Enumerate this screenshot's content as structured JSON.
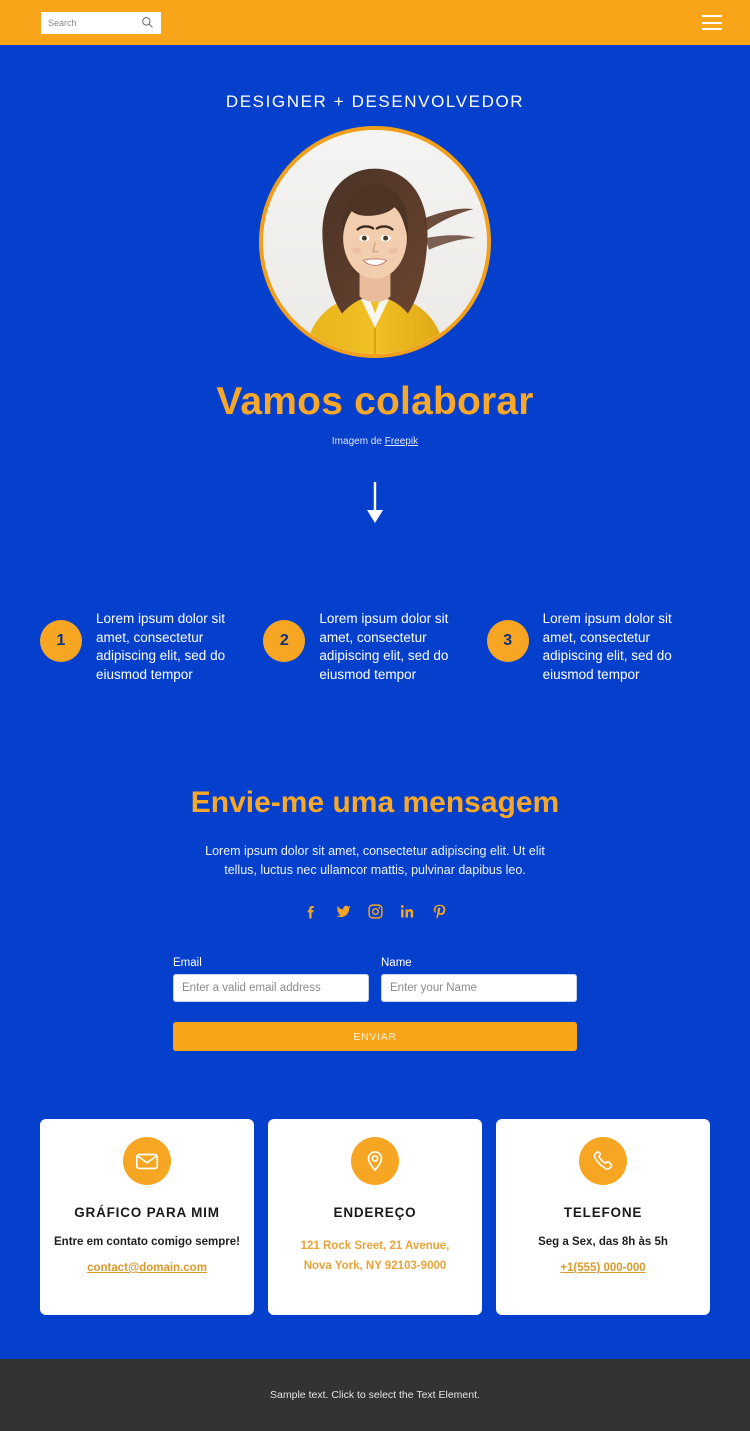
{
  "colors": {
    "background_blue": "#0540cc",
    "accent_orange": "#f9a51a",
    "title_orange": "#f7a82a",
    "footer_dark": "#333333",
    "card_white": "#ffffff"
  },
  "header": {
    "search": {
      "placeholder": "Search",
      "value": "",
      "icon": "search-icon"
    },
    "menu_icon": "hamburger-menu-icon"
  },
  "hero": {
    "eyebrow": "DESIGNER + DESENVOLVEDOR",
    "portrait_alt": "portrait-photo",
    "title": "Vamos colaborar",
    "credit_prefix": "Imagem de ",
    "credit_link": "Freepik",
    "scroll_icon": "arrow-down-icon"
  },
  "steps": [
    {
      "number": "1",
      "text": "Lorem ipsum dolor sit amet, consectetur adipiscing elit, sed do eiusmod tempor"
    },
    {
      "number": "2",
      "text": "Lorem ipsum dolor sit amet, consectetur adipiscing elit, sed do eiusmod tempor"
    },
    {
      "number": "3",
      "text": "Lorem ipsum dolor sit amet, consectetur adipiscing elit, sed do eiusmod tempor"
    }
  ],
  "message": {
    "title": "Envie-me uma mensagem",
    "subtitle": "Lorem ipsum dolor sit amet, consectetur adipiscing elit. Ut elit tellus, luctus nec ullamcor mattis, pulvinar dapibus leo.",
    "socials": [
      {
        "name": "facebook-icon"
      },
      {
        "name": "twitter-icon"
      },
      {
        "name": "instagram-icon"
      },
      {
        "name": "linkedin-icon"
      },
      {
        "name": "pinterest-icon"
      }
    ]
  },
  "form": {
    "email": {
      "label": "Email",
      "placeholder": "Enter a valid email address",
      "value": ""
    },
    "name": {
      "label": "Name",
      "placeholder": "Enter your Name",
      "value": ""
    },
    "submit_label": "ENVIAR"
  },
  "cards": [
    {
      "icon": "envelope-icon",
      "title": "GRÁFICO PARA MIM",
      "subtitle": "Entre em contato comigo sempre!",
      "link": "contact@domain.com",
      "lines": []
    },
    {
      "icon": "location-pin-icon",
      "title": "ENDEREÇO",
      "subtitle": "",
      "link": "",
      "lines": [
        "121 Rock Sreet, 21 Avenue,",
        "Nova York, NY 92103-9000"
      ]
    },
    {
      "icon": "phone-icon",
      "title": "TELEFONE",
      "subtitle": "Seg a Sex, das 8h às 5h",
      "link": "+1(555) 000-000",
      "lines": []
    }
  ],
  "footer": {
    "text": "Sample text. Click to select the Text Element."
  }
}
